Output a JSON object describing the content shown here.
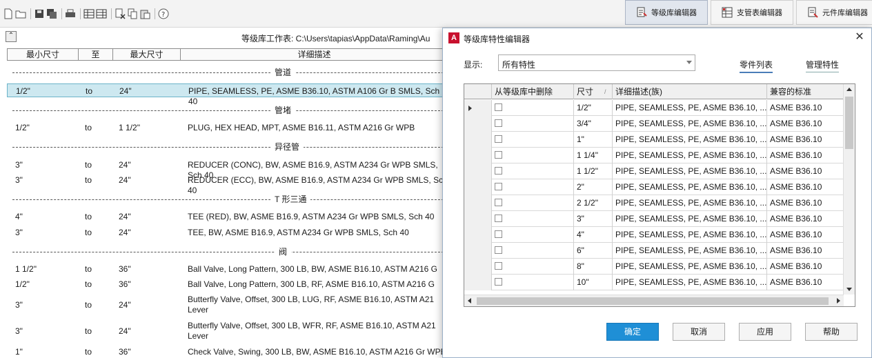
{
  "toolbar": {
    "icons": [
      "new-file-icon",
      "open-folder-icon",
      "save-icon",
      "save-all-icon",
      "print-icon",
      "table-view-icon",
      "table-edit-icon",
      "delete-icon",
      "copy-icon",
      "paste-icon",
      "help-icon"
    ],
    "tabs": [
      {
        "label": "等级库编辑器",
        "icon": "spec-editor-icon",
        "active": true
      },
      {
        "label": "支管表编辑器",
        "icon": "branch-table-icon",
        "active": false
      },
      {
        "label": "元件库编辑器",
        "icon": "catalog-editor-icon",
        "active": false
      }
    ]
  },
  "sheet": {
    "title": "等级库工作表: C:\\Users\\tapias\\AppData\\Raming\\Au",
    "columns": [
      "最小尺寸",
      "至",
      "最大尺寸",
      "详细描述"
    ],
    "groups": [
      {
        "name": "管道",
        "rows": [
          {
            "min": "1/2\"",
            "to": "to",
            "max": "24\"",
            "desc": "PIPE, SEAMLESS, PE, ASME B36.10, ASTM A106 Gr B SMLS, Sch 40",
            "selected": true
          }
        ]
      },
      {
        "name": "管堵",
        "rows": [
          {
            "min": "1/2\"",
            "to": "to",
            "max": "1 1/2\"",
            "desc": "PLUG, HEX HEAD, MPT, ASME B16.11, ASTM A216 Gr WPB"
          }
        ]
      },
      {
        "name": "异径管",
        "rows": [
          {
            "min": "3\"",
            "to": "to",
            "max": "24\"",
            "desc": "REDUCER (CONC), BW, ASME B16.9, ASTM A234 Gr WPB SMLS, Sch 40"
          },
          {
            "min": "3\"",
            "to": "to",
            "max": "24\"",
            "desc": "REDUCER (ECC), BW, ASME B16.9, ASTM A234 Gr WPB SMLS, Sch 40"
          }
        ]
      },
      {
        "name": "T 形三通",
        "rows": [
          {
            "min": "4\"",
            "to": "to",
            "max": "24\"",
            "desc": "TEE (RED), BW, ASME B16.9, ASTM A234 Gr WPB SMLS, Sch 40"
          },
          {
            "min": "3\"",
            "to": "to",
            "max": "24\"",
            "desc": "TEE, BW, ASME B16.9, ASTM A234 Gr WPB SMLS, Sch 40"
          }
        ]
      },
      {
        "name": "阀",
        "rows": [
          {
            "min": "1 1/2\"",
            "to": "to",
            "max": "36\"",
            "desc": "Ball Valve, Long Pattern, 300 LB, BW, ASME B16.10, ASTM A216 G"
          },
          {
            "min": "1/2\"",
            "to": "to",
            "max": "36\"",
            "desc": "Ball Valve, Long Pattern, 300 LB, RF, ASME B16.10, ASTM A216 G"
          },
          {
            "min": "3\"",
            "to": "to",
            "max": "24\"",
            "desc": "Butterfly Valve, Offset, 300 LB, LUG, RF, ASME B16.10, ASTM A21 Lever"
          },
          {
            "min": "3\"",
            "to": "to",
            "max": "24\"",
            "desc": "Butterfly Valve, Offset, 300 LB, WFR, RF, ASME B16.10, ASTM A21 Lever"
          },
          {
            "min": "1\"",
            "to": "to",
            "max": "36\"",
            "desc": "Check Valve, Swing, 300 LB, BW, ASME B16.10, ASTM A216 Gr WPB"
          }
        ]
      }
    ]
  },
  "dialog": {
    "app_badge": "A",
    "title": "等级库特性编辑器",
    "close_symbol": "✕",
    "show_label": "显示:",
    "show_value": "所有特性",
    "tab_parts": "零件列表",
    "tab_manage": "管理特性",
    "grid_columns": [
      "从等级库中删除",
      "尺寸",
      "详细描述(族)",
      "兼容的标准"
    ],
    "sort_indicator": "/",
    "grid_rows": [
      {
        "size": "1/2\"",
        "desc": "PIPE, SEAMLESS, PE, ASME B36.10, ...",
        "std": "ASME B36.10",
        "current": true
      },
      {
        "size": "3/4\"",
        "desc": "PIPE, SEAMLESS, PE, ASME B36.10, ...",
        "std": "ASME B36.10"
      },
      {
        "size": "1\"",
        "desc": "PIPE, SEAMLESS, PE, ASME B36.10, ...",
        "std": "ASME B36.10"
      },
      {
        "size": "1 1/4\"",
        "desc": "PIPE, SEAMLESS, PE, ASME B36.10, ...",
        "std": "ASME B36.10"
      },
      {
        "size": "1 1/2\"",
        "desc": "PIPE, SEAMLESS, PE, ASME B36.10, ...",
        "std": "ASME B36.10"
      },
      {
        "size": "2\"",
        "desc": "PIPE, SEAMLESS, PE, ASME B36.10, ...",
        "std": "ASME B36.10"
      },
      {
        "size": "2 1/2\"",
        "desc": "PIPE, SEAMLESS, PE, ASME B36.10, ...",
        "std": "ASME B36.10"
      },
      {
        "size": "3\"",
        "desc": "PIPE, SEAMLESS, PE, ASME B36.10, ...",
        "std": "ASME B36.10"
      },
      {
        "size": "4\"",
        "desc": "PIPE, SEAMLESS, PE, ASME B36.10, ...",
        "std": "ASME B36.10"
      },
      {
        "size": "6\"",
        "desc": "PIPE, SEAMLESS, PE, ASME B36.10, ...",
        "std": "ASME B36.10"
      },
      {
        "size": "8\"",
        "desc": "PIPE, SEAMLESS, PE, ASME B36.10, ...",
        "std": "ASME B36.10"
      },
      {
        "size": "10\"",
        "desc": "PIPE, SEAMLESS, PE, ASME B36.10, ...",
        "std": "ASME B36.10"
      }
    ],
    "buttons": {
      "ok": "确定",
      "cancel": "取消",
      "apply": "应用",
      "help": "帮助"
    }
  },
  "colors": {
    "accent": "#1f8fd6",
    "selection": "#cde8f0",
    "autodesk_red": "#c8102e"
  }
}
